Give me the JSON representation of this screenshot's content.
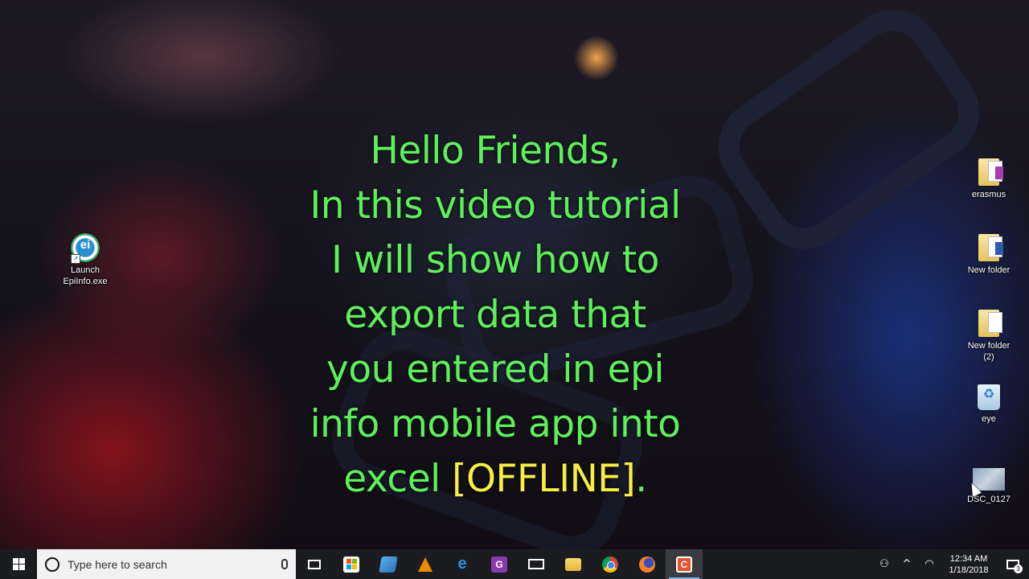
{
  "desktop_icons": {
    "epiinfo": {
      "label_line1": "Launch",
      "label_line2": "EpiInfo.exe",
      "glyph": "ei"
    },
    "erasmus": {
      "label": "erasmus"
    },
    "new_folder": {
      "label": "New folder"
    },
    "new_folder_2": {
      "label_line1": "New folder",
      "label_line2": "(2)"
    },
    "eye": {
      "label": "eye"
    },
    "dsc": {
      "label": "DSC_0127"
    }
  },
  "caption": {
    "line1": "Hello Friends,",
    "line2": "In this video tutorial",
    "line3": "I will show how to",
    "line4": "export data that",
    "line5": "you entered in epi",
    "line6": "info mobile app into",
    "line7_prefix": "excel ",
    "line7_highlight": "[OFFLINE]",
    "line7_suffix": ".",
    "colors": {
      "main": "#5ef05a",
      "highlight": "#f5ee43"
    }
  },
  "taskbar": {
    "search_placeholder": "Type here to search",
    "apps": [
      {
        "name": "task-view-icon"
      },
      {
        "name": "store-icon"
      },
      {
        "name": "vmware-icon"
      },
      {
        "name": "vlc-icon"
      },
      {
        "name": "edge-icon"
      },
      {
        "name": "pdf-editor-icon",
        "glyph": "G"
      },
      {
        "name": "mail-icon"
      },
      {
        "name": "file-explorer-icon"
      },
      {
        "name": "chrome-icon"
      },
      {
        "name": "firefox-icon"
      },
      {
        "name": "camtasia-icon",
        "glyph": "C"
      }
    ],
    "clock": {
      "time": "12:34 AM",
      "date": "1/18/2018"
    },
    "notification_count": "3"
  }
}
